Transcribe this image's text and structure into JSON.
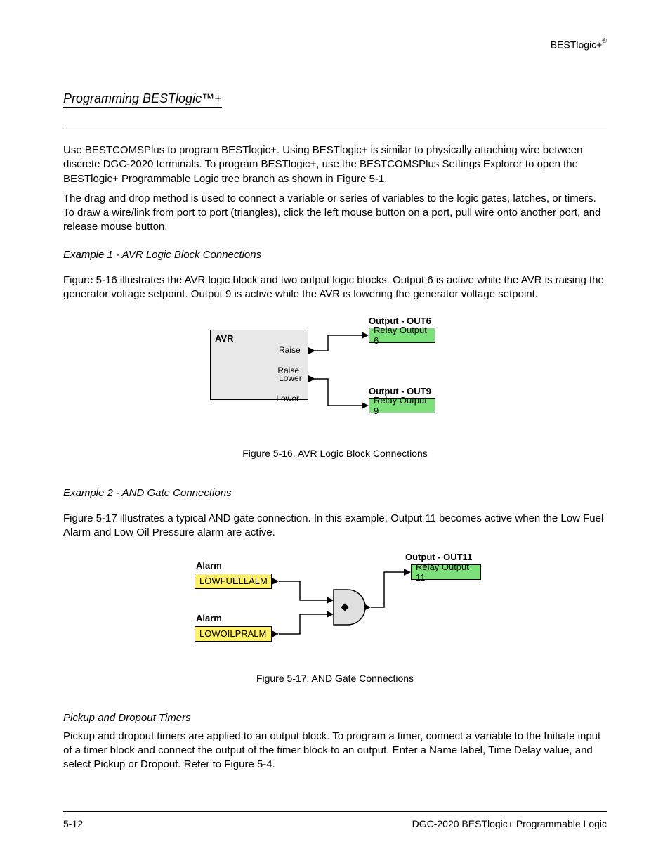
{
  "header": {
    "logic_label": "BESTlogic+",
    "reg_mark": "®"
  },
  "section_heading": "Programming BESTlogic™+",
  "intro_rule": true,
  "paragraphs": {
    "intro": "Use BESTCOMSPlus to program BESTlogic+. Using BESTlogic+ is similar to physically attaching wire between discrete DGC-2020 terminals. To program BESTlogic+, use the BESTCOMSPlus Settings Explorer to open the BESTlogic+ Programmable Logic tree branch as shown in Figure 5-1.",
    "intro2": "The drag and drop method is used to connect a variable or series of variables to the logic gates, latches, or timers. To draw a wire/link from port to port (triangles), click the left mouse button on a port, pull wire onto another port, and release mouse button.",
    "ex1_title": "Example 1 - AVR Logic Block Connections",
    "ex1_text": "Figure 5-16 illustrates the AVR logic block and two output logic blocks. Output 6 is active while the AVR is raising the generator voltage setpoint. Output 9 is active while the AVR is lowering the generator voltage setpoint.",
    "ex2_title": "Example 2 - AND Gate Connections",
    "ex2_text": "Figure 5-17 illustrates a typical AND gate connection. In this example, Output 11 becomes active when the Low Fuel Alarm and Low Oil Pressure alarm are active.",
    "pickup_text": "Pickup and dropout timers are applied to an output block. To program a timer, connect a variable to the Initiate input of a timer block and connect the output of the timer block to an output. Enter a Name label, Time Delay value, and select Pickup or Dropout. Refer to Figure 5-4.",
    "subsection_heading": "Pickup and Dropout Timers"
  },
  "fig1": {
    "avr_label": "AVR",
    "port_raise": "Raise",
    "port_lower": "Lower",
    "out6_label": "Output - OUT6",
    "out6_text": "Relay Output 6",
    "out9_label": "Output - OUT9",
    "out9_text": "Relay Output 9",
    "caption": "Figure 5-16. AVR Logic Block Connections"
  },
  "fig2": {
    "alarm1_label": "Alarm",
    "alarm1_text": "LOWFUELLALM",
    "alarm2_label": "Alarm",
    "alarm2_text": "LOWOILPRALM",
    "out11_label": "Output - OUT11",
    "out11_text": "Relay Output 11",
    "caption": "Figure 5-17. AND Gate Connections"
  },
  "footer": {
    "page": "5-12",
    "right": "DGC-2020 BESTlogic+ Programmable Logic"
  }
}
